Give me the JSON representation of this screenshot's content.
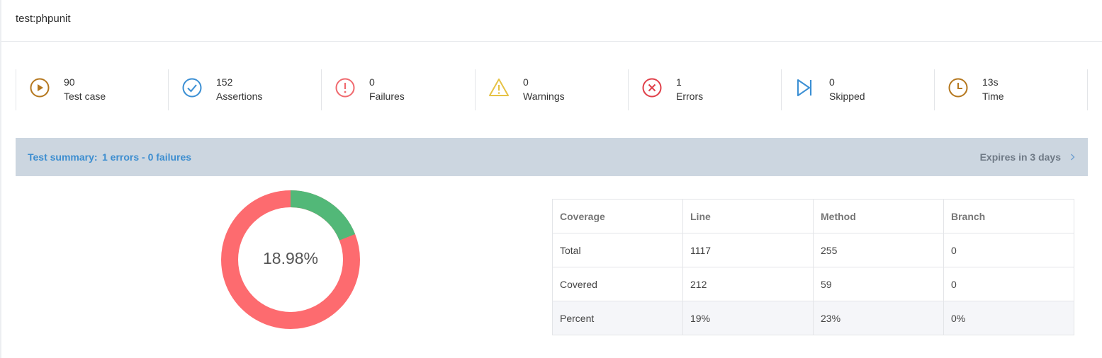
{
  "header": {
    "title": "test:phpunit"
  },
  "stats": [
    {
      "value": "90",
      "label": "Test case",
      "icon": "play-circle-icon",
      "color": "#b5781f"
    },
    {
      "value": "152",
      "label": "Assertions",
      "icon": "check-circle-icon",
      "color": "#3b8fd4"
    },
    {
      "value": "0",
      "label": "Failures",
      "icon": "exclamation-circle-icon",
      "color": "#f06a6f"
    },
    {
      "value": "0",
      "label": "Warnings",
      "icon": "warning-triangle-icon",
      "color": "#e6c245"
    },
    {
      "value": "1",
      "label": "Errors",
      "icon": "x-circle-icon",
      "color": "#e0404a"
    },
    {
      "value": "0",
      "label": "Skipped",
      "icon": "skip-icon",
      "color": "#3b8fd4"
    },
    {
      "value": "13s",
      "label": "Time",
      "icon": "clock-icon",
      "color": "#b5781f"
    }
  ],
  "summary": {
    "label": "Test summary:",
    "value": "1 errors - 0 failures",
    "expires": "Expires in 3 days"
  },
  "coverage_chart": {
    "percent_label": "18.98%",
    "covered_fraction": 0.1898,
    "covered_color": "#52b878",
    "uncovered_color": "#fd6b6f"
  },
  "coverage_table": {
    "headers": [
      "Coverage",
      "Line",
      "Method",
      "Branch"
    ],
    "rows": [
      [
        "Total",
        "1117",
        "255",
        "0"
      ],
      [
        "Covered",
        "212",
        "59",
        "0"
      ],
      [
        "Percent",
        "19%",
        "23%",
        "0%"
      ]
    ]
  }
}
